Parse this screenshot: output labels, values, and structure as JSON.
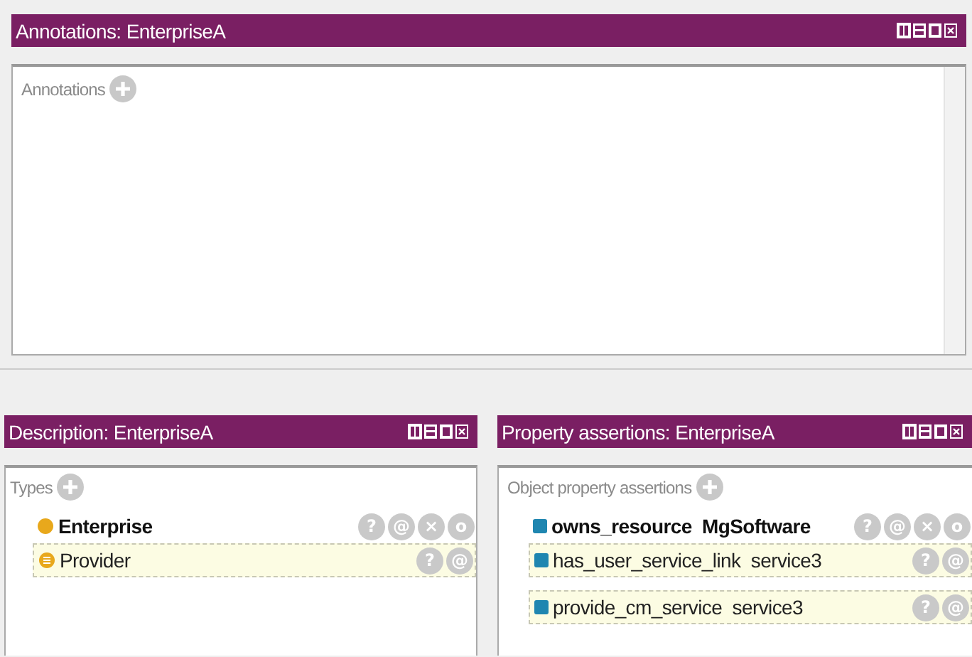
{
  "annotations_panel": {
    "title": "Annotations: EnterpriseA",
    "section_label": "Annotations"
  },
  "description_panel": {
    "title": "Description: EnterpriseA",
    "section_label": "Types",
    "rows": [
      {
        "kind": "asserted",
        "text": "Enterprise",
        "buttons": [
          "?",
          "@",
          "×",
          "o"
        ]
      },
      {
        "kind": "inferred",
        "text": "Provider",
        "buttons": [
          "?",
          "@"
        ]
      }
    ]
  },
  "property_panel": {
    "title": "Property assertions: EnterpriseA",
    "section_label": "Object property assertions",
    "rows": [
      {
        "kind": "asserted",
        "text": "owns_resource  MgSoftware",
        "buttons": [
          "?",
          "@",
          "×",
          "o"
        ]
      },
      {
        "kind": "inferred",
        "text": "has_user_service_link  service3",
        "buttons": [
          "?",
          "@"
        ]
      },
      {
        "kind": "inferred",
        "text": "provide_cm_service  service3",
        "buttons": [
          "?",
          "@"
        ]
      }
    ]
  }
}
